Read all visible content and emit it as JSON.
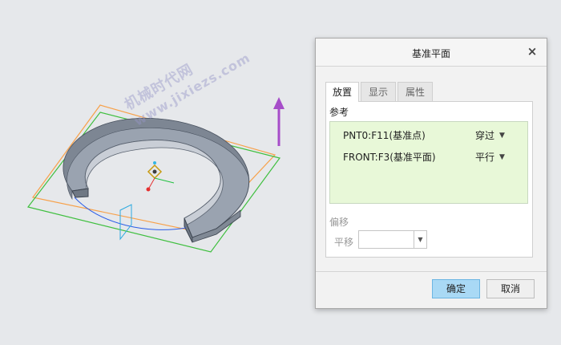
{
  "viewport": {
    "watermark_line1": "机械时代网",
    "watermark_line2": "www.jixiezs.com"
  },
  "dialog": {
    "title": "基准平面",
    "close_glyph": "×",
    "tabs": [
      {
        "label": "放置",
        "active": true
      },
      {
        "label": "显示",
        "active": false
      },
      {
        "label": "属性",
        "active": false
      }
    ],
    "references_label": "参考",
    "references": [
      {
        "name": "PNT0:F11(基准点)",
        "constraint": "穿过"
      },
      {
        "name": "FRONT:F3(基准平面)",
        "constraint": "平行"
      }
    ],
    "offset_label": "偏移",
    "translate_label": "平移",
    "translate_value": "",
    "ok_label": "确定",
    "cancel_label": "取消"
  },
  "colors": {
    "accent": "#a9d9f5",
    "reference_bg": "#e8f8d8",
    "plane_orange": "#f7a14a",
    "plane_green": "#3fbf3f",
    "arrow_purple": "#a64dc9"
  }
}
